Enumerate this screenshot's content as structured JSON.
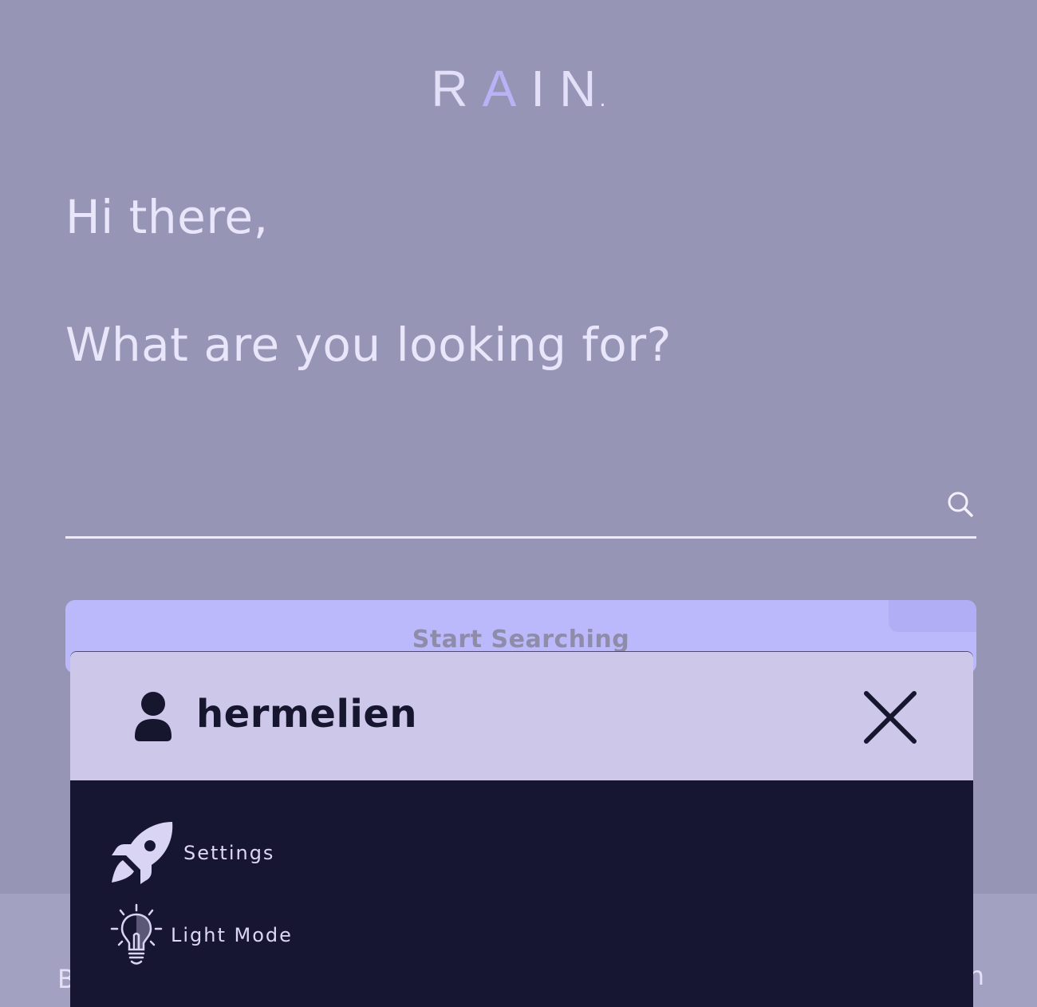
{
  "brand": {
    "logo_letters": [
      "R",
      "A",
      "I",
      "N",
      "."
    ],
    "accent_color": "#b8b3f5"
  },
  "hero": {
    "greeting": "Hi there,",
    "question": "What are you looking for?"
  },
  "search": {
    "value": "",
    "placeholder": "",
    "icon": "search-icon"
  },
  "start_button": {
    "label": "Start Searching"
  },
  "bottom_bar": {
    "left_text": "B",
    "right_text": "n"
  },
  "user_menu": {
    "username": "hermelien",
    "user_icon": "user-icon",
    "close_icon": "close-icon",
    "items": [
      {
        "label": "Settings",
        "icon": "rocket-icon"
      },
      {
        "label": "Light Mode",
        "icon": "lightbulb-icon"
      }
    ]
  },
  "colors": {
    "background": "#9695b5",
    "button": "#bbb8fb",
    "panel_header": "#cdc8ea",
    "panel_body": "#161633"
  }
}
